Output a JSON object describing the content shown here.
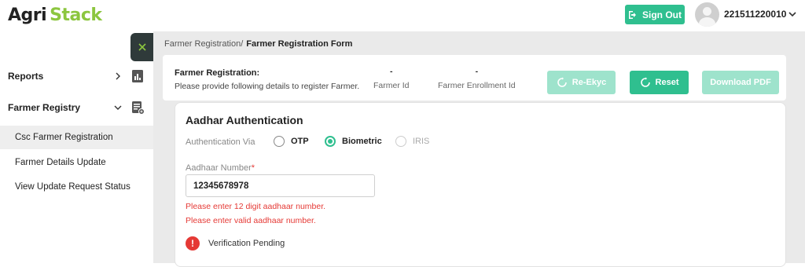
{
  "header": {
    "logo_part1": "Agri",
    "logo_part2": "Stack",
    "sign_out_label": "Sign Out",
    "user_id": "221511220010"
  },
  "sidebar": {
    "reports_label": "Reports",
    "farmer_registry_label": "Farmer Registry",
    "sub_items": [
      {
        "label": "Csc Farmer Registration",
        "active": true
      },
      {
        "label": "Farmer Details Update",
        "active": false
      },
      {
        "label": "View Update Request Status",
        "active": false
      }
    ]
  },
  "breadcrumb": {
    "parent": "Farmer Registration/",
    "current": "Farmer Registration Form"
  },
  "info": {
    "title": "Farmer Registration:",
    "subtitle": "Please provide following details to register Farmer.",
    "farmer_id_value": "-",
    "farmer_id_label": "Farmer Id",
    "enrollment_id_value": "-",
    "enrollment_id_label": "Farmer Enrollment Id",
    "re_ekyc_label": "Re-Ekyc",
    "reset_label": "Reset",
    "download_label": "Download PDF"
  },
  "form": {
    "title": "Aadhar Authentication",
    "auth_via_label": "Authentication Via",
    "options": [
      "OTP",
      "Biometric",
      "IRIS"
    ],
    "selected_option": "Biometric",
    "aadhaar_label": "Aadhaar Number",
    "aadhaar_required_mark": "*",
    "aadhaar_value": "12345678978",
    "errors": [
      "Please enter 12 digit aadhaar number.",
      "Please enter valid aadhaar number."
    ],
    "verification_status": "Verification Pending"
  },
  "colors": {
    "accent": "#2fbf8f",
    "accent_light": "#9ee3cc",
    "error": "#e53935",
    "logo_green": "#8cc63f"
  }
}
